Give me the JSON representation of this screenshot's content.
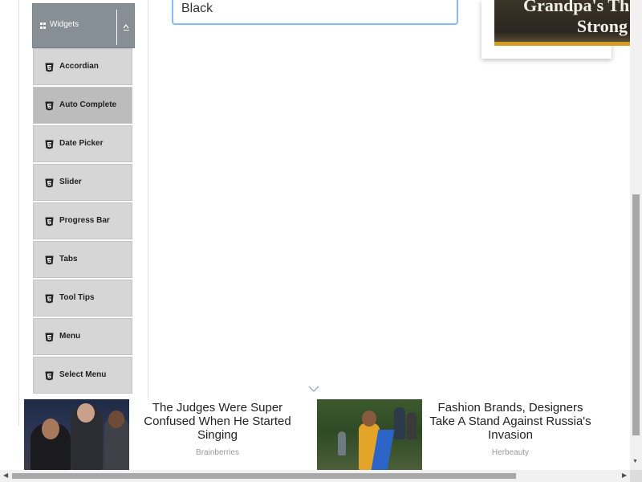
{
  "sidebar": {
    "group_title": "Widgets",
    "group_icon": "grid-icon",
    "collapse_icon": "collapse-up-icon",
    "item_icon": "html5-icon",
    "items": [
      {
        "label": "Accordian",
        "active": false
      },
      {
        "label": "Auto Complete",
        "active": true
      },
      {
        "label": "Date Picker",
        "active": false
      },
      {
        "label": "Slider",
        "active": false
      },
      {
        "label": "Progress Bar",
        "active": false
      },
      {
        "label": "Tabs",
        "active": false
      },
      {
        "label": "Tool Tips",
        "active": false
      },
      {
        "label": "Menu",
        "active": false
      },
      {
        "label": "Select Menu",
        "active": false
      }
    ]
  },
  "main": {
    "input_value": "Black",
    "input_border_color": "#80bdff"
  },
  "top_ad": {
    "headline_line1": "Grandpa's The",
    "headline_line2": "Strong"
  },
  "bottom_ad": {
    "cards": [
      {
        "headline": "The Judges Were Super Confused When He Started Singing",
        "source": "Brainberries"
      },
      {
        "headline": "Fashion Brands, Designers Take A Stand Against Russia's Invasion",
        "source": "Herbeauty"
      }
    ]
  },
  "colors": {
    "widgets_header_bg": "#868e96",
    "menu_item_bg": "#d6d6d6",
    "menu_item_active_bg": "#bcbcbc",
    "ad_band": "#d19d1f"
  }
}
